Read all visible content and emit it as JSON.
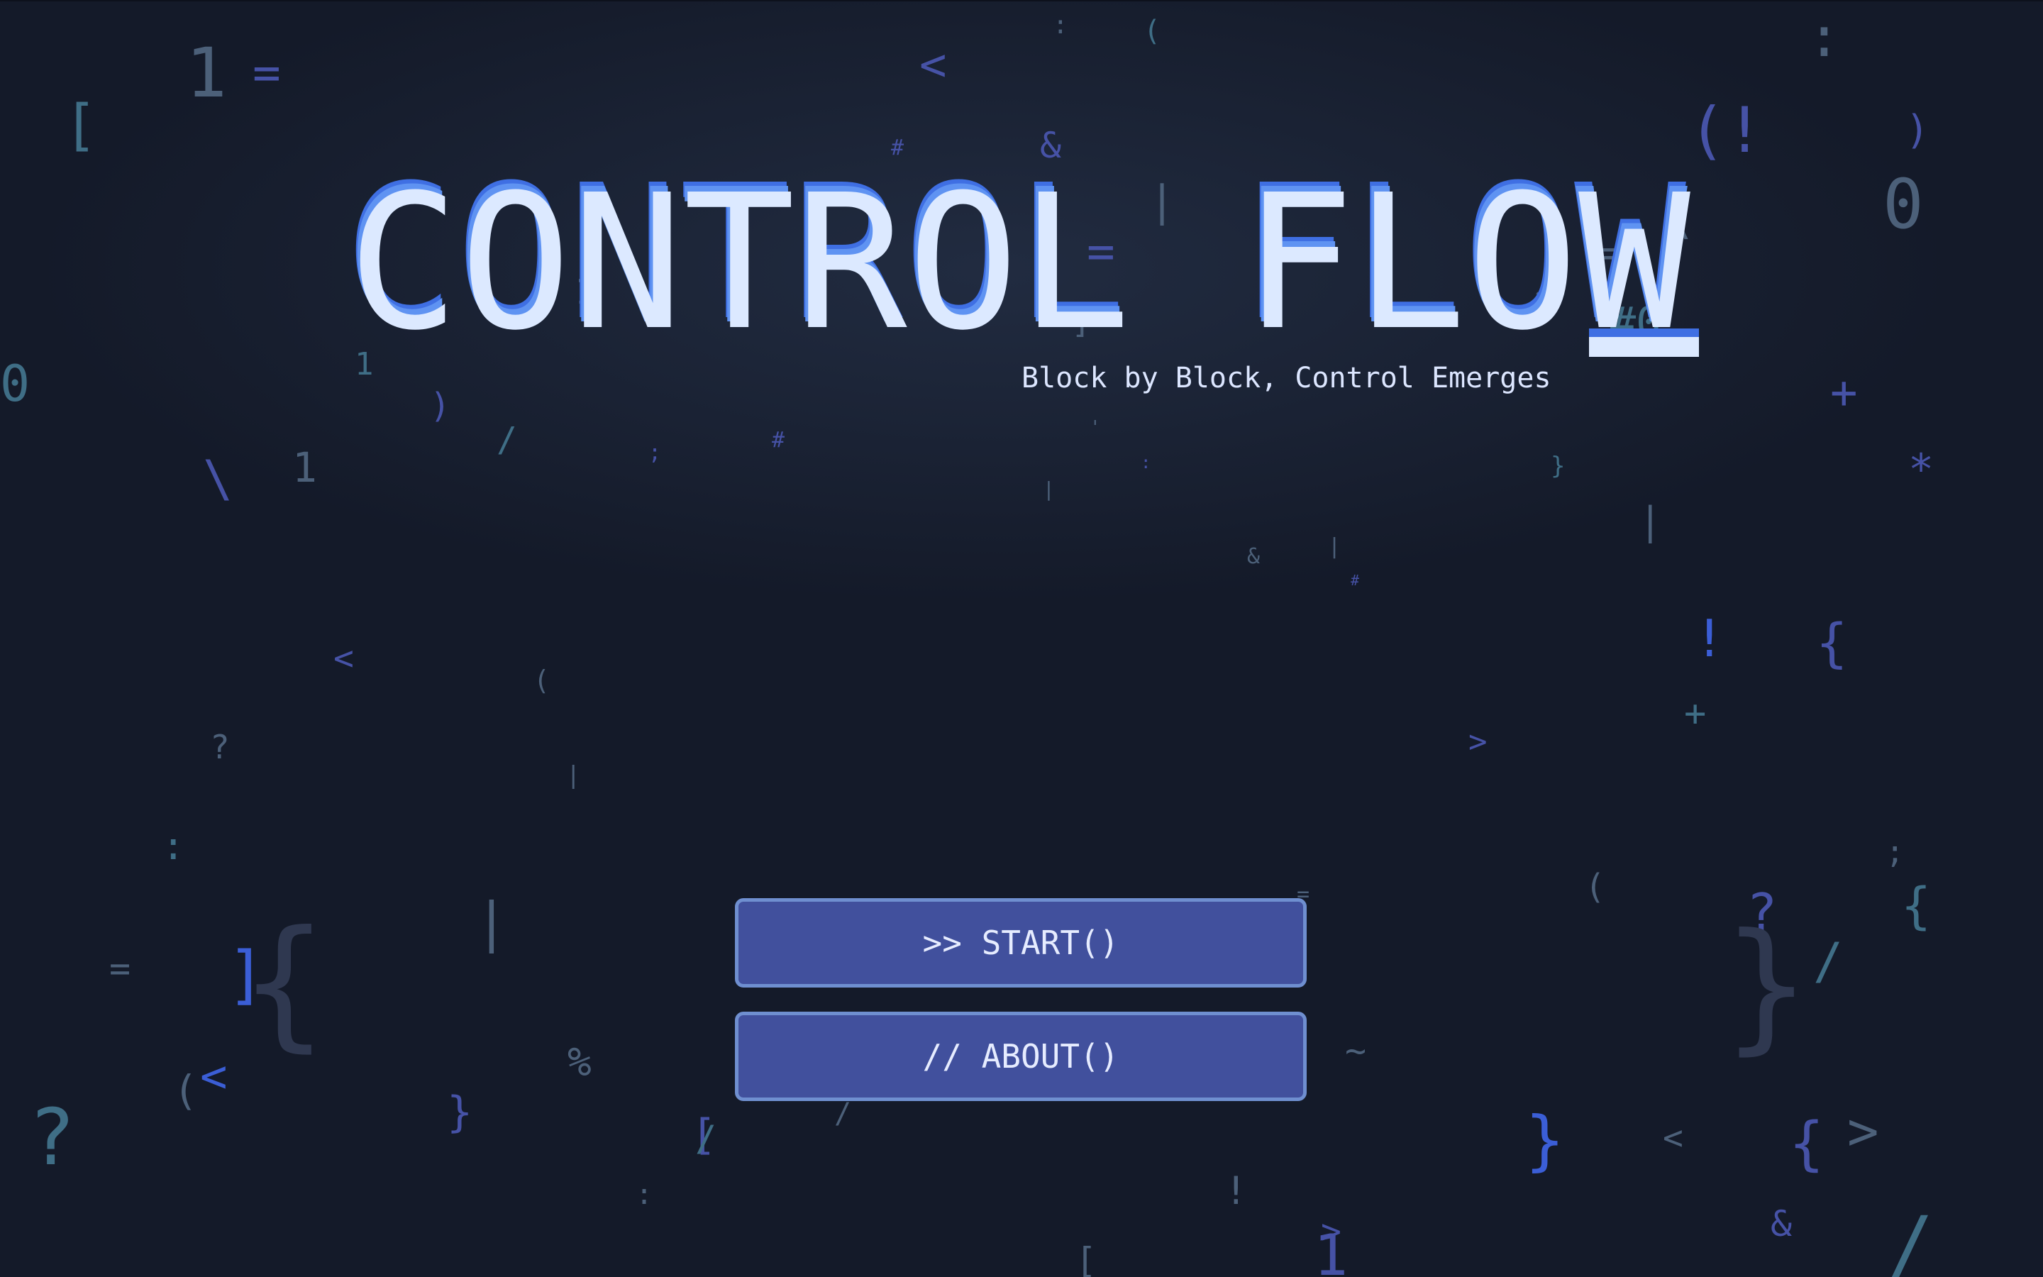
{
  "title": {
    "text": "CONTROL FLOW",
    "subtitle": "Block by Block, Control Emerges"
  },
  "menu": {
    "start_label": ">> START()",
    "about_label": "// ABOUT()"
  },
  "colors": {
    "background": "#141a29",
    "title_fill": "#dce9ff",
    "title_shadow_light": "#5f93f2",
    "title_shadow_dark": "#3f6fe3",
    "button_fill": "#41509d",
    "button_border": "#6f8fd0",
    "button_text": "#e6ecff"
  },
  "background_glyphs": [
    "1",
    "=",
    "[",
    "<",
    ":",
    "(",
    ":",
    "(!",
    ")",
    "0",
    "#",
    "&",
    "|",
    "\\",
    "=",
    "*",
    "#0",
    "1",
    "1",
    "+",
    ")",
    "/",
    ";",
    "#",
    "\\",
    "1",
    ":",
    "}",
    "*",
    "|",
    "&",
    "|",
    "#",
    "!",
    "{",
    "<",
    "(",
    ">",
    "+",
    "?",
    "|",
    ";",
    ":",
    "(",
    "?",
    "{",
    "|",
    "{",
    "=",
    "]",
    "}",
    "/",
    "%",
    "~",
    "(",
    "<",
    "}",
    "?",
    "[",
    "/",
    "/",
    "}",
    "<",
    "{",
    ">",
    ":",
    "!",
    ">",
    "&",
    "1",
    "[",
    "/",
    "<",
    "=",
    "1",
    "]",
    "0",
    "'",
    "|",
    "="
  ]
}
